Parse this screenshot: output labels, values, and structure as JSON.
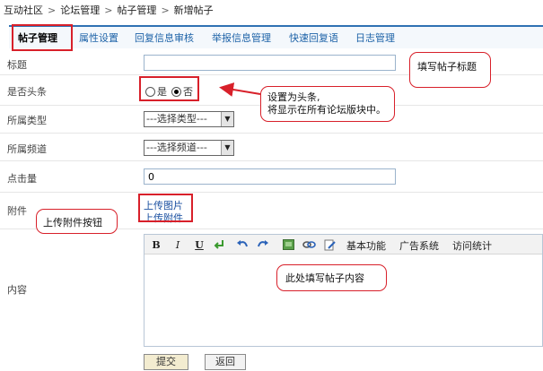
{
  "breadcrumb": [
    "互动社区",
    "论坛管理",
    "帖子管理",
    "新增帖子"
  ],
  "breadcrumb_separator": ">",
  "tabs": [
    "帖子管理",
    "属性设置",
    "回复信息审核",
    "举报信息管理",
    "快速回复语",
    "日志管理"
  ],
  "active_tab": "帖子管理",
  "form": {
    "title_label": "标题",
    "title_value": "",
    "headline_label": "是否头条",
    "headline_yes": "是",
    "headline_no": "否",
    "headline_selected": "否",
    "type_label": "所属类型",
    "type_value": "---选择类型---",
    "channel_label": "所属频道",
    "channel_value": "---选择频道---",
    "clicks_label": "点击量",
    "clicks_value": "0",
    "attach_label": "附件",
    "upload_image": "上传图片",
    "upload_attach": "上传附件",
    "content_label": "内容"
  },
  "editor": {
    "bold": "B",
    "italic": "I",
    "underline": "U",
    "toolbar_menus": [
      "基本功能",
      "广告系统",
      "访问统计"
    ]
  },
  "buttons": {
    "submit": "提交",
    "back": "返回"
  },
  "annotations": {
    "title_note": "填写帖子标题",
    "headline_note_line1": "设置为头条,",
    "headline_note_line2": "将显示在所有论坛版块中。",
    "attach_note": "上传附件按钮",
    "content_note": "此处填写帖子内容"
  },
  "colors": {
    "accent": "#2f71b3",
    "link": "#1e63a8",
    "annotation": "#d8202a"
  }
}
